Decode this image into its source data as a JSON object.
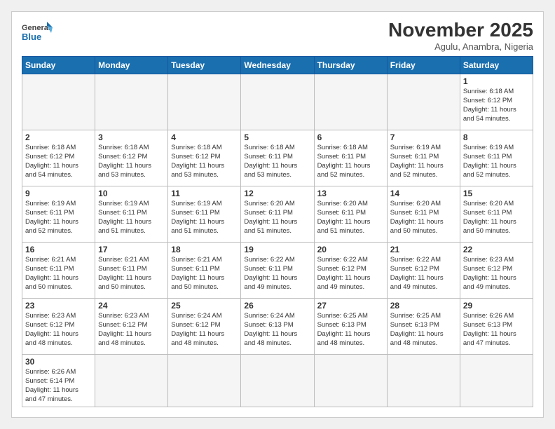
{
  "header": {
    "logo_general": "General",
    "logo_blue": "Blue",
    "month_title": "November 2025",
    "location": "Agulu, Anambra, Nigeria"
  },
  "weekdays": [
    "Sunday",
    "Monday",
    "Tuesday",
    "Wednesday",
    "Thursday",
    "Friday",
    "Saturday"
  ],
  "days": [
    {
      "num": "",
      "info": ""
    },
    {
      "num": "",
      "info": ""
    },
    {
      "num": "",
      "info": ""
    },
    {
      "num": "",
      "info": ""
    },
    {
      "num": "",
      "info": ""
    },
    {
      "num": "",
      "info": ""
    },
    {
      "num": "1",
      "info": "Sunrise: 6:18 AM\nSunset: 6:12 PM\nDaylight: 11 hours\nand 54 minutes."
    },
    {
      "num": "2",
      "info": "Sunrise: 6:18 AM\nSunset: 6:12 PM\nDaylight: 11 hours\nand 54 minutes."
    },
    {
      "num": "3",
      "info": "Sunrise: 6:18 AM\nSunset: 6:12 PM\nDaylight: 11 hours\nand 53 minutes."
    },
    {
      "num": "4",
      "info": "Sunrise: 6:18 AM\nSunset: 6:12 PM\nDaylight: 11 hours\nand 53 minutes."
    },
    {
      "num": "5",
      "info": "Sunrise: 6:18 AM\nSunset: 6:11 PM\nDaylight: 11 hours\nand 53 minutes."
    },
    {
      "num": "6",
      "info": "Sunrise: 6:18 AM\nSunset: 6:11 PM\nDaylight: 11 hours\nand 52 minutes."
    },
    {
      "num": "7",
      "info": "Sunrise: 6:19 AM\nSunset: 6:11 PM\nDaylight: 11 hours\nand 52 minutes."
    },
    {
      "num": "8",
      "info": "Sunrise: 6:19 AM\nSunset: 6:11 PM\nDaylight: 11 hours\nand 52 minutes."
    },
    {
      "num": "9",
      "info": "Sunrise: 6:19 AM\nSunset: 6:11 PM\nDaylight: 11 hours\nand 52 minutes."
    },
    {
      "num": "10",
      "info": "Sunrise: 6:19 AM\nSunset: 6:11 PM\nDaylight: 11 hours\nand 51 minutes."
    },
    {
      "num": "11",
      "info": "Sunrise: 6:19 AM\nSunset: 6:11 PM\nDaylight: 11 hours\nand 51 minutes."
    },
    {
      "num": "12",
      "info": "Sunrise: 6:20 AM\nSunset: 6:11 PM\nDaylight: 11 hours\nand 51 minutes."
    },
    {
      "num": "13",
      "info": "Sunrise: 6:20 AM\nSunset: 6:11 PM\nDaylight: 11 hours\nand 51 minutes."
    },
    {
      "num": "14",
      "info": "Sunrise: 6:20 AM\nSunset: 6:11 PM\nDaylight: 11 hours\nand 50 minutes."
    },
    {
      "num": "15",
      "info": "Sunrise: 6:20 AM\nSunset: 6:11 PM\nDaylight: 11 hours\nand 50 minutes."
    },
    {
      "num": "16",
      "info": "Sunrise: 6:21 AM\nSunset: 6:11 PM\nDaylight: 11 hours\nand 50 minutes."
    },
    {
      "num": "17",
      "info": "Sunrise: 6:21 AM\nSunset: 6:11 PM\nDaylight: 11 hours\nand 50 minutes."
    },
    {
      "num": "18",
      "info": "Sunrise: 6:21 AM\nSunset: 6:11 PM\nDaylight: 11 hours\nand 50 minutes."
    },
    {
      "num": "19",
      "info": "Sunrise: 6:22 AM\nSunset: 6:11 PM\nDaylight: 11 hours\nand 49 minutes."
    },
    {
      "num": "20",
      "info": "Sunrise: 6:22 AM\nSunset: 6:12 PM\nDaylight: 11 hours\nand 49 minutes."
    },
    {
      "num": "21",
      "info": "Sunrise: 6:22 AM\nSunset: 6:12 PM\nDaylight: 11 hours\nand 49 minutes."
    },
    {
      "num": "22",
      "info": "Sunrise: 6:23 AM\nSunset: 6:12 PM\nDaylight: 11 hours\nand 49 minutes."
    },
    {
      "num": "23",
      "info": "Sunrise: 6:23 AM\nSunset: 6:12 PM\nDaylight: 11 hours\nand 48 minutes."
    },
    {
      "num": "24",
      "info": "Sunrise: 6:23 AM\nSunset: 6:12 PM\nDaylight: 11 hours\nand 48 minutes."
    },
    {
      "num": "25",
      "info": "Sunrise: 6:24 AM\nSunset: 6:12 PM\nDaylight: 11 hours\nand 48 minutes."
    },
    {
      "num": "26",
      "info": "Sunrise: 6:24 AM\nSunset: 6:13 PM\nDaylight: 11 hours\nand 48 minutes."
    },
    {
      "num": "27",
      "info": "Sunrise: 6:25 AM\nSunset: 6:13 PM\nDaylight: 11 hours\nand 48 minutes."
    },
    {
      "num": "28",
      "info": "Sunrise: 6:25 AM\nSunset: 6:13 PM\nDaylight: 11 hours\nand 48 minutes."
    },
    {
      "num": "29",
      "info": "Sunrise: 6:26 AM\nSunset: 6:13 PM\nDaylight: 11 hours\nand 47 minutes."
    },
    {
      "num": "30",
      "info": "Sunrise: 6:26 AM\nSunset: 6:14 PM\nDaylight: 11 hours\nand 47 minutes."
    },
    {
      "num": "",
      "info": ""
    },
    {
      "num": "",
      "info": ""
    },
    {
      "num": "",
      "info": ""
    },
    {
      "num": "",
      "info": ""
    },
    {
      "num": "",
      "info": ""
    },
    {
      "num": "",
      "info": ""
    }
  ]
}
